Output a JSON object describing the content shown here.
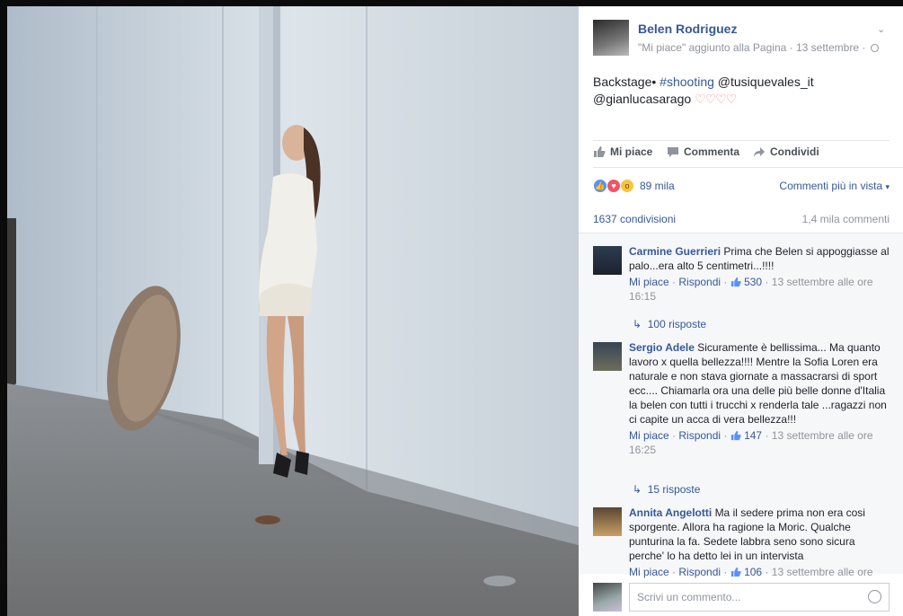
{
  "post": {
    "page_name": "Belen Rodriguez",
    "meta_activity": "\"Mi piace\" aggiunto alla Pagina",
    "meta_sep": " · ",
    "meta_date": "13 settembre",
    "meta_sep2": " · ",
    "text_prefix": "Backstage• ",
    "hashtag": "#shooting",
    "text_mid": " @tusiquevales_it",
    "text_line2": "@gianlucasarago",
    "hearts": "♡♡♡♡"
  },
  "actions": {
    "like": "Mi piace",
    "comment": "Commenta",
    "share": "Condividi"
  },
  "reactions": {
    "count": "89 mila",
    "sort": "Commenti più in vista",
    "sort_arrow": "▾"
  },
  "stats": {
    "shares": "1637 condivisioni",
    "comments": "1,4 mila commenti"
  },
  "comments": [
    {
      "name": "Carmine Guerrieri",
      "text": "Prima che Belen si appoggiasse al palo...era alto 5 centimetri...!!!!",
      "like": "Mi piace",
      "reply": "Rispondi",
      "likes": "530",
      "time": "13 settembre alle ore 16:15",
      "replies": "100 risposte"
    },
    {
      "name": "Sergio Adele",
      "text": "Sicuramente è bellissima... Ma quanto lavoro x quella bellezza!!!! Mentre la Sofia Loren era naturale e non stava giornate a massacrarsi di sport ecc.... Chiamarla ora una delle più belle donne d'Italia la belen con tutti i trucchi x renderla tale ...ragazzi non ci capite un acca di vera bellezza!!!",
      "like": "Mi piace",
      "reply": "Rispondi",
      "likes": "147",
      "time": "13 settembre alle ore 16:25",
      "replies": "15 risposte"
    },
    {
      "name": "Annita Angelotti",
      "text": "Ma il sedere prima non era cosi sporgente. Allora ha ragione la Moric. Qualche punturina la fa. Sedete labbra seno sono sicura perche' lo ha detto lei in un intervista",
      "like": "Mi piace",
      "reply": "Rispondi",
      "likes": "106",
      "time": "13 settembre alle ore"
    }
  ],
  "write": {
    "placeholder": "Scrivi un commento..."
  },
  "colors": {
    "link": "#365899",
    "muted": "#90949c",
    "like_blue": "#5890ff",
    "love_red": "#f25268",
    "wow_yellow": "#f7c440"
  },
  "icons": [
    "chevron-down-icon",
    "globe-icon",
    "like-icon",
    "comment-icon",
    "share-icon",
    "reply-arrow-icon",
    "smiley-icon"
  ]
}
